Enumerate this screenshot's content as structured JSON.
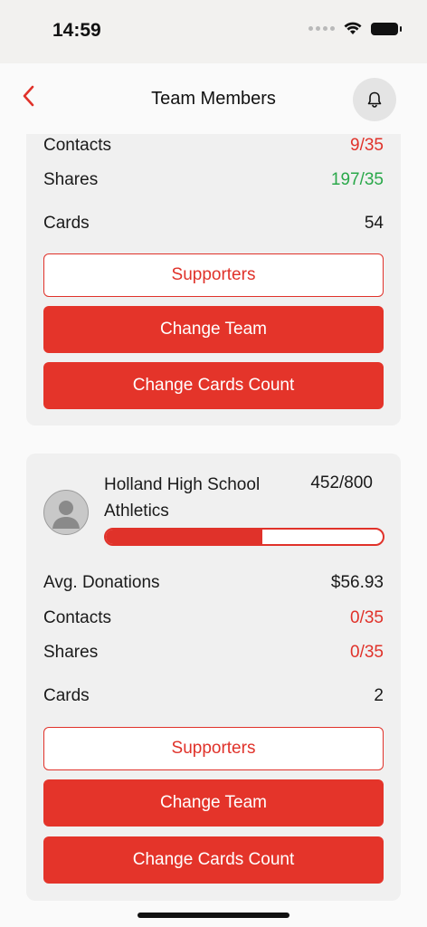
{
  "status": {
    "time": "14:59"
  },
  "header": {
    "title": "Team Members"
  },
  "card1": {
    "contacts_label": "Contacts",
    "contacts_value": "9/35",
    "shares_label": "Shares",
    "shares_value": "197/35",
    "cards_label": "Cards",
    "cards_value": "54",
    "supporters_label": "Supporters",
    "change_team_label": "Change Team",
    "change_cards_label": "Change Cards Count"
  },
  "card2": {
    "team_name": "Holland High School Athletics",
    "progress_text": "452/800",
    "progress_fraction": 0.565,
    "avg_label": "Avg. Donations",
    "avg_value": "$56.93",
    "contacts_label": "Contacts",
    "contacts_value": "0/35",
    "shares_label": "Shares",
    "shares_value": "0/35",
    "cards_label": "Cards",
    "cards_value": "2",
    "supporters_label": "Supporters",
    "change_team_label": "Change Team",
    "change_cards_label": "Change Cards Count"
  },
  "colors": {
    "accent": "#e0322a",
    "positive": "#2aa84a"
  }
}
